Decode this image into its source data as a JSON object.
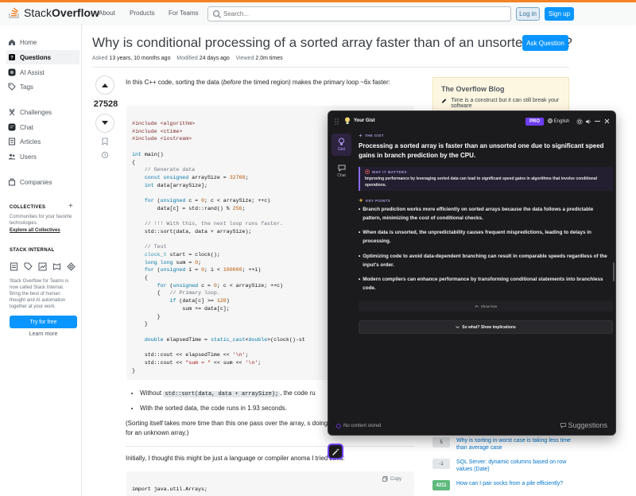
{
  "header": {
    "logo_text_a": "Stack",
    "logo_text_b": "Overflow",
    "nav": [
      "About",
      "Products",
      "For Teams"
    ],
    "search_placeholder": "Search...",
    "login": "Log in",
    "signup": "Sign up"
  },
  "sidebar": {
    "items": [
      {
        "label": "Home",
        "icon": "home-icon"
      },
      {
        "label": "Questions",
        "icon": "questions-icon",
        "active": true
      },
      {
        "label": "AI Assist",
        "icon": "ai-assist-icon"
      },
      {
        "label": "Tags",
        "icon": "tag-icon"
      },
      {
        "label": "Challenges",
        "icon": "challenges-icon"
      },
      {
        "label": "Chat",
        "icon": "chat-icon"
      },
      {
        "label": "Articles",
        "icon": "articles-icon"
      },
      {
        "label": "Users",
        "icon": "users-icon"
      },
      {
        "label": "Companies",
        "icon": "companies-icon"
      }
    ],
    "collectives_title": "COLLECTIVES",
    "collectives_text": "Communities for your favorite technologies.",
    "collectives_link": "Explore all Collectives",
    "internal_title": "STACK INTERNAL",
    "internal_text": "Stack Overflow for Teams is now called Stack Internal. Bring the best of human thought and AI automation together at your work.",
    "try_free": "Try for free",
    "learn_more": "Learn more"
  },
  "question": {
    "title": "Why is conditional processing of a sorted array faster than of an unsorted array?",
    "ask_button": "Ask Question",
    "asked_label": "Asked",
    "asked_value": "13 years, 10 months ago",
    "modified_label": "Modified",
    "modified_value": "24 days ago",
    "viewed_label": "Viewed",
    "viewed_value": "2.0m times",
    "votes": "27528",
    "intro_a": "In this C++ code, sorting the data (",
    "intro_em": "before",
    "intro_b": " the timed region) makes the primary loop ~6x faster:",
    "bullet1_a": "Without ",
    "bullet1_code": "std::sort(data, data + arraySize);",
    "bullet1_b": ", the code ru",
    "bullet2": "With the sorted data, the code runs in 1.93 seconds.",
    "para2": "(Sorting itself takes more time than this one pass over the array, s doing if we needed to calculate this for an unknown array.)",
    "para3": "Initially, I thought this might be just a language or compiler anoma  I tried Java:",
    "copy": "Copy",
    "java_line": "import java.util.Arrays;"
  },
  "blog": {
    "title": "The Overflow Blog",
    "item": "Time is a construct but it can still break your software"
  },
  "related": [
    {
      "score": "5",
      "text": "Why is sorting in worst case is taking less time than average case",
      "accepted": false
    },
    {
      "score": "-1",
      "text": "SQL Server: dynamic columns based on row values (Date)",
      "accepted": false
    },
    {
      "score": "4211",
      "text": "How can I pair socks from a pile efficiently?",
      "accepted": true
    }
  ],
  "gist": {
    "title": "Your Gist",
    "pro": "PRO",
    "language": "English",
    "tabs": [
      "Gist",
      "Chat"
    ],
    "section_gist": "THE GIST",
    "headline": "Processing a sorted array is faster than an unsorted one due to significant speed gains in branch prediction by the CPU.",
    "why_label": "WHY IT MATTERS",
    "why_text": "Improving performance by leveraging sorted data can lead to significant speed gains in algorithms that involve conditional operations.",
    "kp_label": "KEY POINTS",
    "points": [
      "Branch prediction works more efficiently on sorted arrays because the data follows a predictable pattern, minimizing the cost of conditional checks.",
      "When data is unsorted, the unpredictability causes frequent mispredictions, leading to delays in processing.",
      "Optimizing code to avoid data-dependent branching can result in comparable speeds regardless of the input's order.",
      "Modern compilers can enhance performance by transforming conditional statements into branchless code."
    ],
    "show_less": "Show less",
    "so_what": "So what? Show implications",
    "footer": "No content stored",
    "suggestions": "Suggestions"
  }
}
